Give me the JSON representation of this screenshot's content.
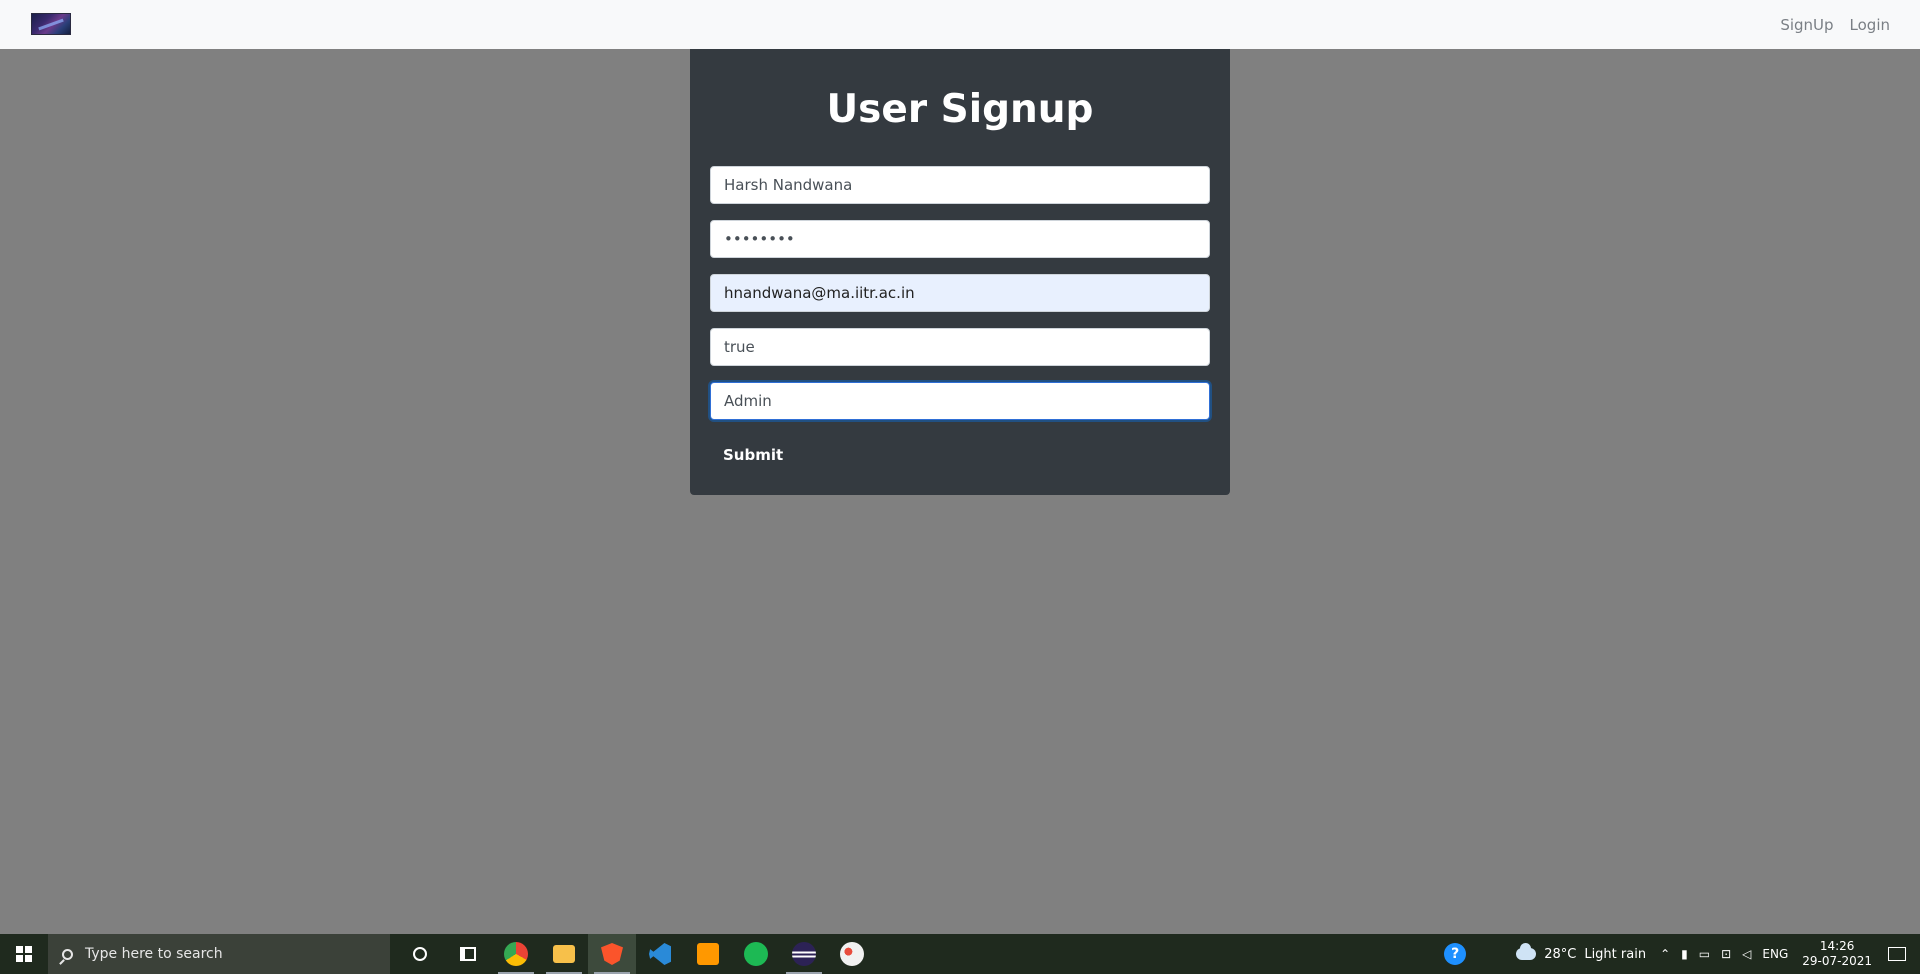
{
  "navbar": {
    "logo": "brand-logo",
    "links": [
      "SignUp",
      "Login"
    ]
  },
  "form": {
    "title": "User Signup",
    "fields": {
      "name": "Harsh Nandwana",
      "password": "••••••••",
      "email": "hnandwana@ma.iitr.ac.in",
      "flag": "true",
      "role": "Admin"
    },
    "submit_label": "Submit"
  },
  "taskbar": {
    "search_placeholder": "Type here to search",
    "apps": [
      "cortana-icon",
      "task-view-icon",
      "chrome-icon",
      "file-explorer-icon",
      "brave-icon",
      "vscode-icon",
      "sublime-text-icon",
      "spotify-icon",
      "eclipse-icon",
      "paint-icon"
    ],
    "help": "?",
    "weather": {
      "temperature": "28°C",
      "condition": "Light rain"
    },
    "language": "ENG",
    "time": "14:26",
    "date": "29-07-2021"
  },
  "colors": {
    "page_background": "#808080",
    "card_background": "#343a40",
    "navbar_background": "#f8f9fa",
    "focus_border": "#2f6fd6"
  }
}
